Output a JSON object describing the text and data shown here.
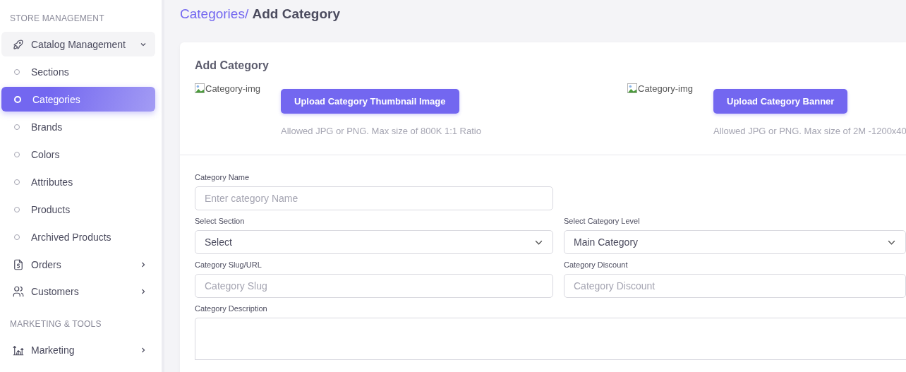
{
  "sidebar": {
    "sections": [
      {
        "heading": "STORE MANAGEMENT",
        "items": [
          {
            "label": "Catalog Management",
            "expanded": true,
            "children": [
              {
                "label": "Sections",
                "selected": false
              },
              {
                "label": "Categories",
                "selected": true
              },
              {
                "label": "Brands",
                "selected": false
              },
              {
                "label": "Colors",
                "selected": false
              },
              {
                "label": "Attributes",
                "selected": false
              },
              {
                "label": "Products",
                "selected": false
              },
              {
                "label": "Archived Products",
                "selected": false
              }
            ]
          },
          {
            "label": "Orders",
            "expanded": false
          },
          {
            "label": "Customers",
            "expanded": false
          }
        ]
      },
      {
        "heading": "MARKETING & TOOLS",
        "items": [
          {
            "label": "Marketing",
            "expanded": false
          }
        ]
      }
    ]
  },
  "breadcrumb": {
    "parent": "Categories/",
    "current": "Add Category"
  },
  "card": {
    "title": "Add Category",
    "uploads": [
      {
        "image_alt": "Category-img",
        "button": "Upload Category Thumbnail Image",
        "hint": "Allowed JPG or PNG. Max size of 800K 1:1 Ratio"
      },
      {
        "image_alt": "Category-img",
        "button": "Upload Category Banner",
        "hint": "Allowed JPG or PNG. Max size of 2M -1200x40"
      }
    ],
    "fields": [
      {
        "label": "Category Name",
        "kind": "input",
        "placeholder": "Enter category Name"
      },
      {
        "kind": "spacer"
      },
      {
        "label": "Select Section",
        "kind": "select",
        "value": "Select"
      },
      {
        "label": "Select Category Level",
        "kind": "select",
        "value": "Main Category"
      },
      {
        "label": "Category Slug/URL",
        "kind": "input",
        "placeholder": "Category Slug"
      },
      {
        "label": "Category Discount",
        "kind": "input",
        "placeholder": "Category Discount"
      },
      {
        "label": "Category Description",
        "kind": "textarea"
      }
    ]
  }
}
